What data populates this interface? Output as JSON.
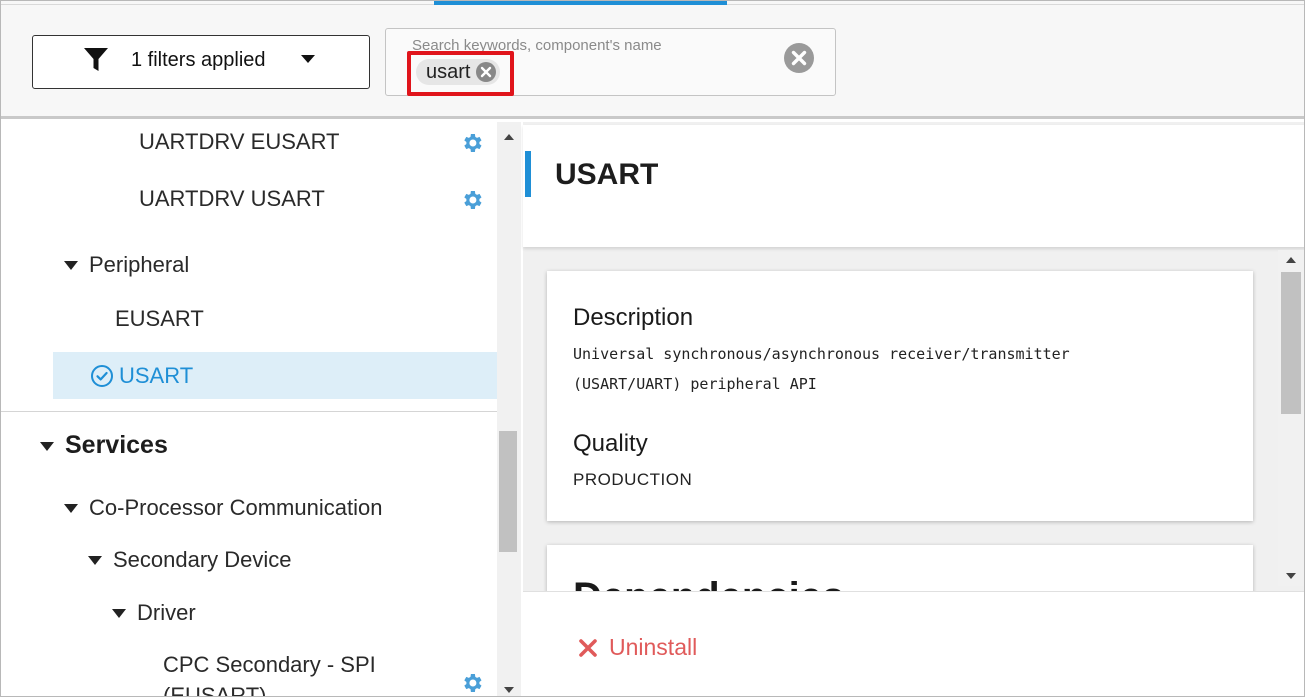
{
  "toolbar": {
    "filter_label": "1 filters applied",
    "search_placeholder": "Search keywords, component's name",
    "search_chip": "usart"
  },
  "tree": {
    "items": [
      {
        "label": "UARTDRV EUSART",
        "has_gear": true
      },
      {
        "label": "UARTDRV USART",
        "has_gear": true
      },
      {
        "label": "Peripheral",
        "expanded": true
      },
      {
        "label": "EUSART"
      },
      {
        "label": "USART",
        "selected": true,
        "installed": true
      },
      {
        "label": "Services",
        "expanded": true,
        "bold": true
      },
      {
        "label": "Co-Processor Communication",
        "expanded": true
      },
      {
        "label": "Secondary Device",
        "expanded": true
      },
      {
        "label": "Driver",
        "expanded": true
      },
      {
        "label": "CPC Secondary - SPI",
        "has_gear": true
      },
      {
        "label": "(EUSART)"
      }
    ]
  },
  "detail": {
    "title": "USART",
    "description_heading": "Description",
    "description_line1": "Universal synchronous/asynchronous receiver/transmitter",
    "description_line2": "(USART/UART) peripheral API",
    "quality_heading": "Quality",
    "quality_value": "PRODUCTION",
    "next_card_title": "Dependencies"
  },
  "footer": {
    "uninstall_label": "Uninstall"
  },
  "colors": {
    "accent": "#1f8fd6",
    "highlight_box": "#e0141b",
    "uninstall": "#e05a5a",
    "selected_bg": "#ddeef8"
  }
}
